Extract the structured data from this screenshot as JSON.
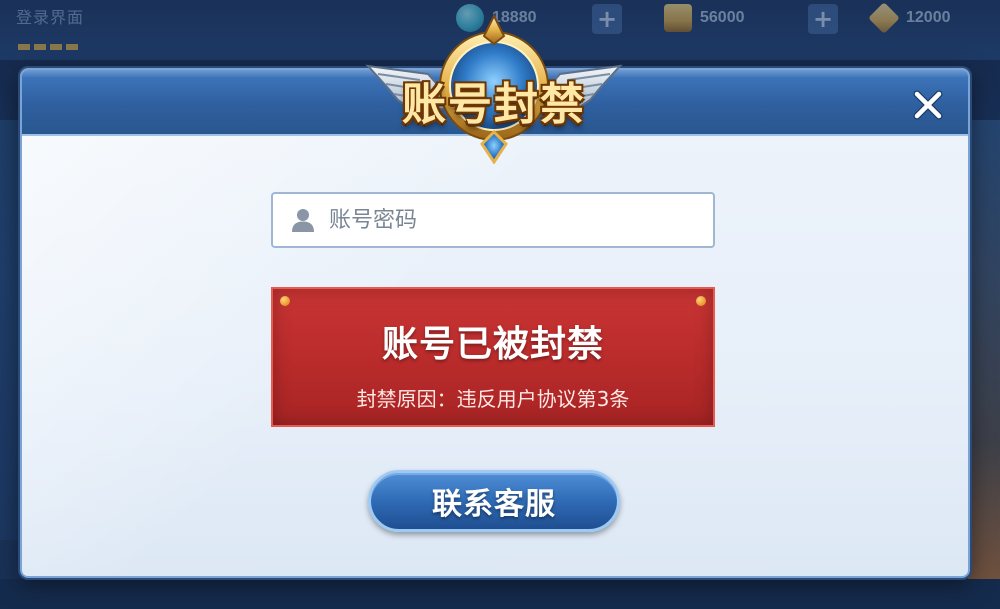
{
  "background": {
    "title": "登录界面",
    "currencies": [
      {
        "icon": "diamond-icon",
        "value": "18880",
        "color": "#36b6c9"
      },
      {
        "icon": "coin-icon",
        "value": "56000",
        "color": "#e0a93a"
      },
      {
        "icon": "gem-icon",
        "value": "12000",
        "color": "#e6b24a"
      }
    ]
  },
  "dialog": {
    "title": "账号封禁",
    "close_label": "✕",
    "account_input": {
      "placeholder": "账号密码",
      "value": ""
    },
    "ban_notice": {
      "title": "账号已被封禁",
      "reason": "封禁原因：违反用户协议第3条"
    },
    "contact_button_label": "联系客服"
  },
  "colors": {
    "header_blue": "#2f5f9f",
    "ban_red": "#b92b2b",
    "button_blue": "#2f6bb6",
    "title_gold": "#ffe7a6"
  }
}
